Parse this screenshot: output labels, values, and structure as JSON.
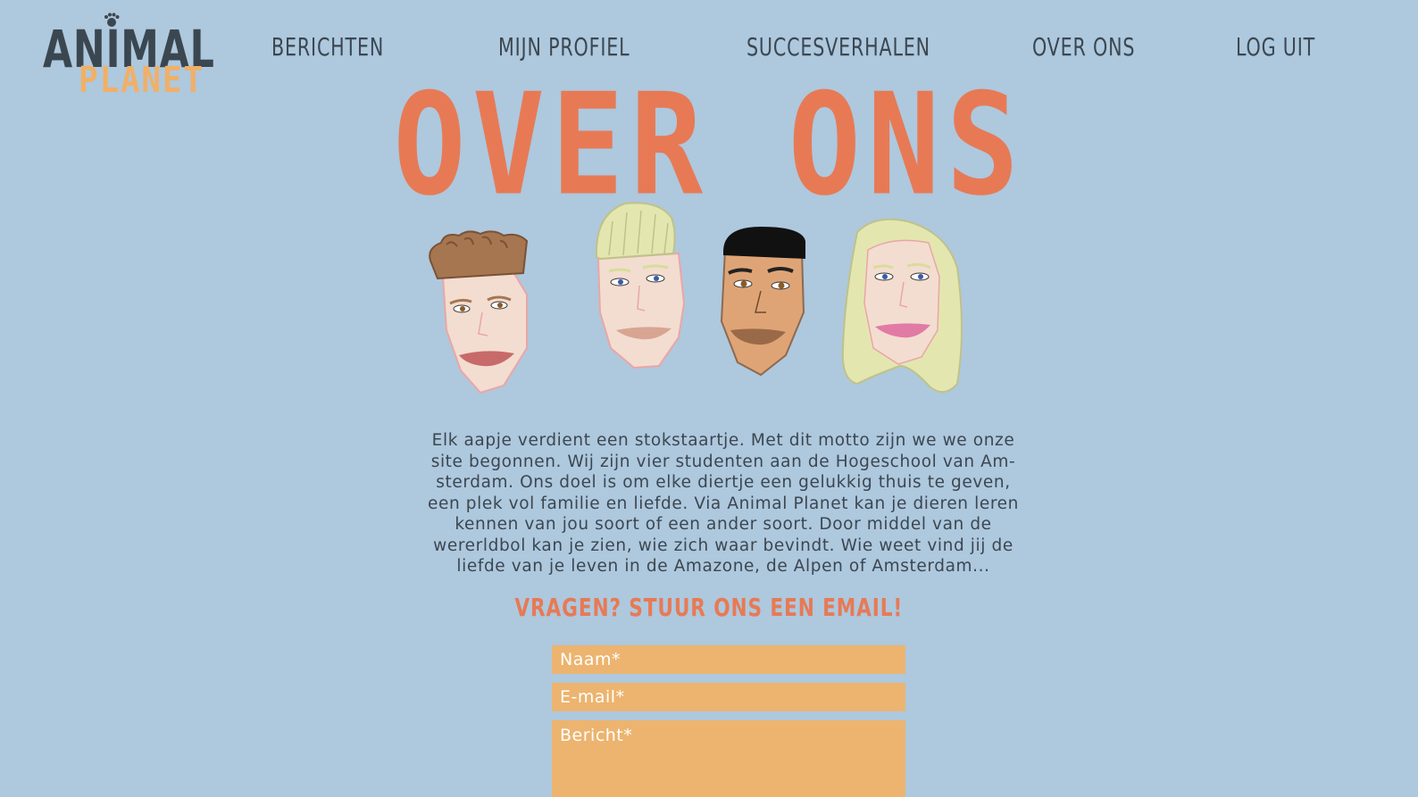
{
  "brand": {
    "name_line1": "ANIMAL",
    "name_line2": "PLANET",
    "colors": {
      "dark": "#3b4750",
      "orange": "#f0b068",
      "accent": "#e77a55",
      "background": "#aec8de",
      "field": "#ecb46f"
    }
  },
  "nav": {
    "items": [
      {
        "label": "BERICHTEN"
      },
      {
        "label": "MIJN PROFIEL"
      },
      {
        "label": "SUCCESVERHALEN"
      },
      {
        "label": "OVER ONS"
      },
      {
        "label": "LOG UIT"
      }
    ]
  },
  "page": {
    "title": "OVER ONS",
    "team_illustration": [
      "brown-hair-man-face",
      "blonde-man-face",
      "black-hair-man-face",
      "blonde-woman-face"
    ],
    "about_lines": [
      "Elk aapje verdient een stokstaartje. Met dit motto zijn we we onze",
      "site begonnen. Wij zijn vier studenten aan de Hogeschool van Am-",
      "sterdam. Ons doel is om elke diertje een gelukkig thuis te geven,",
      "een plek vol familie en liefde. Via Animal Planet kan je dieren leren",
      "kennen van jou soort of een ander soort. Door middel van de",
      "wererldbol kan je zien, wie zich waar bevindt. Wie weet vind jij de",
      "liefde van je leven in de Amazone, de Alpen of Amsterdam..."
    ],
    "contact_heading": "VRAGEN? STUUR ONS EEN EMAIL!"
  },
  "form": {
    "name_placeholder": "Naam*",
    "email_placeholder": "E-mail*",
    "message_placeholder": "Bericht*"
  }
}
